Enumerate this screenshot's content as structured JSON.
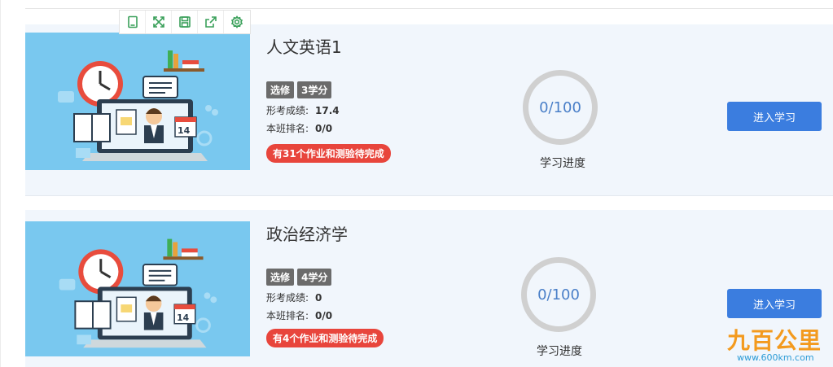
{
  "toolbar": {
    "icons": [
      "tablet-icon",
      "expand-icon",
      "save-icon",
      "share-icon",
      "settings-icon"
    ]
  },
  "courses": [
    {
      "title": "人文英语1",
      "tags": [
        "选修",
        "3学分"
      ],
      "score_label": "形考成绩:",
      "score_value": "17.4",
      "rank_label": "本班排名:",
      "rank_value": "0/0",
      "warning": "有31个作业和测验待完成",
      "progress_text": "0/100",
      "progress_value": 0,
      "progress_label": "学习进度",
      "button_label": "进入学习",
      "thumb_calendar": "14"
    },
    {
      "title": "政治经济学",
      "tags": [
        "选修",
        "4学分"
      ],
      "score_label": "形考成绩:",
      "score_value": "0",
      "rank_label": "本班排名:",
      "rank_value": "0/0",
      "warning": "有4个作业和测验待完成",
      "progress_text": "0/100",
      "progress_value": 0,
      "progress_label": "学习进度",
      "button_label": "进入学习",
      "thumb_calendar": "14"
    }
  ],
  "watermark": {
    "logo": "九百公里",
    "url": "www.600km.com"
  },
  "colors": {
    "accent": "#3b7ddf",
    "warning": "#e8453c",
    "toolbar_icon": "#3aa05a",
    "thumb_bg": "#79c8ef",
    "progress_text": "#4a7fc8"
  }
}
